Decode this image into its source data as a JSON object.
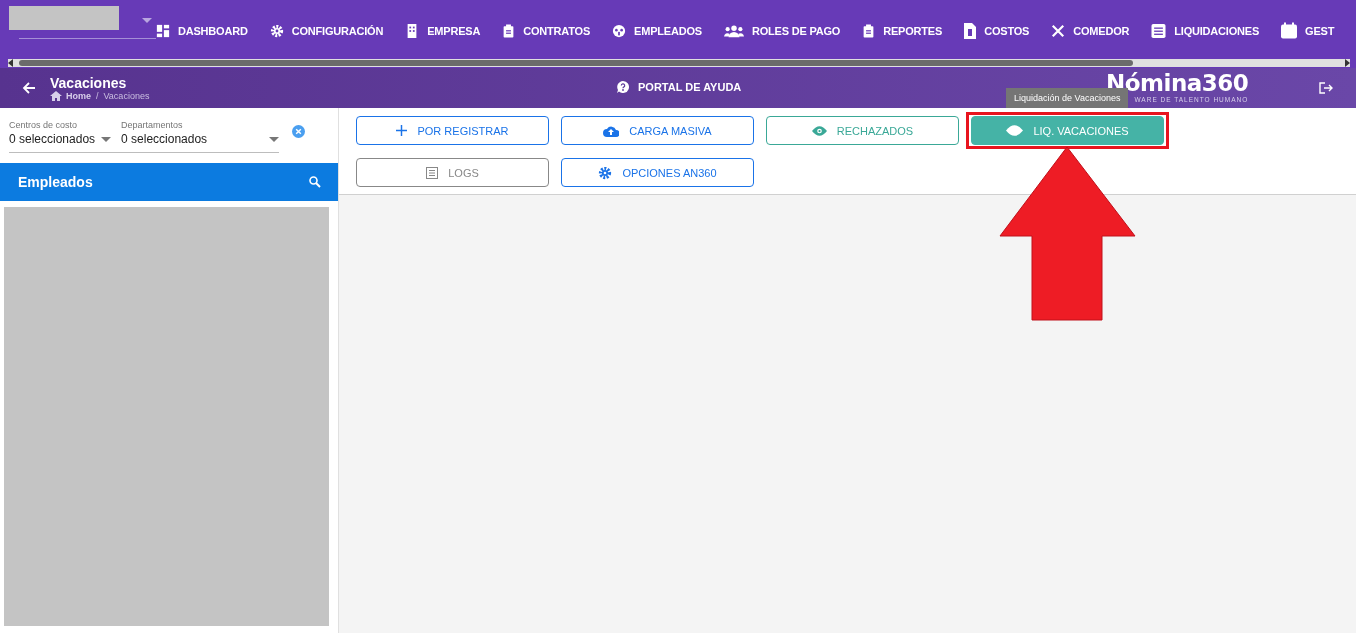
{
  "nav": {
    "items": [
      {
        "label": "DASHBOARD"
      },
      {
        "label": "CONFIGURACIÓN"
      },
      {
        "label": "EMPRESA"
      },
      {
        "label": "CONTRATOS"
      },
      {
        "label": "EMPLEADOS"
      },
      {
        "label": "ROLES DE PAGO"
      },
      {
        "label": "REPORTES"
      },
      {
        "label": "COSTOS"
      },
      {
        "label": "COMEDOR"
      },
      {
        "label": "LIQUIDACIONES"
      },
      {
        "label": "GEST"
      }
    ]
  },
  "header": {
    "title": "Vacaciones",
    "breadcrumb": [
      "Home",
      "Vacaciones"
    ],
    "breadcrumb_separator": "/",
    "help": "PORTAL DE AYUDA",
    "logo": "Nómina360",
    "logo_tagline": "WARE DE TALENTO HUMANO"
  },
  "filters": [
    {
      "label": "Centros de costo",
      "value": "0 seleccionados"
    },
    {
      "label": "Departamentos",
      "value": "0 seleccionados"
    }
  ],
  "employees_panel": {
    "title": "Empleados"
  },
  "actions": [
    {
      "label": "POR REGISTRAR",
      "color": "#1a73e8",
      "filled": false,
      "highlighted": false
    },
    {
      "label": "CARGA MASIVA",
      "color": "#1a73e8",
      "filled": false,
      "highlighted": false
    },
    {
      "label": "RECHAZADOS",
      "color": "#3aa897",
      "filled": false,
      "highlighted": false
    },
    {
      "label": "LIQ. VACACIONES",
      "color": "#45b3a6",
      "filled": true,
      "highlighted": true
    },
    {
      "label": "LOGS",
      "color": "#888888",
      "filled": false,
      "highlighted": false
    },
    {
      "label": "OPCIONES AN360",
      "color": "#1a73e8",
      "filled": false,
      "highlighted": false
    }
  ],
  "tooltip": "Liquidación de Vacaciones"
}
